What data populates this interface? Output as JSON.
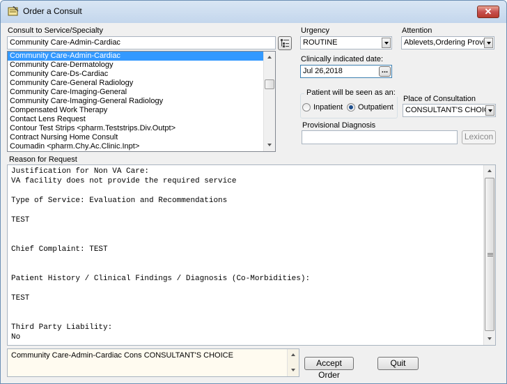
{
  "window": {
    "title": "Order a Consult",
    "close_symbol": "✕"
  },
  "service": {
    "label": "Consult to Service/Specialty",
    "value": "Community Care-Admin-Cardiac",
    "picker_icon": "tree-view-icon",
    "items": [
      "Community Care-Admin-Cardiac",
      "Community Care-Dermatology",
      "Community Care-Ds-Cardiac",
      "Community Care-General Radiology",
      "Community Care-Imaging-General",
      "Community Care-Imaging-General Radiology",
      "Compensated Work Therapy",
      "Contact Lens Request",
      "Contour Test Strips  <pharm.Teststrips.Div.Outpt>",
      "Contract Nursing Home Consult",
      "Coumadin  <pharm.Chy.Ac.Clinic.Inpt>"
    ],
    "selected_index": 0
  },
  "urgency": {
    "label": "Urgency",
    "value": "ROUTINE"
  },
  "attention": {
    "label": "Attention",
    "value": "Ablevets,Ordering Provic"
  },
  "clinical_date": {
    "label": "Clinically indicated date:",
    "value": "Jul 26,2018",
    "button_label": "..."
  },
  "patient_seen": {
    "label": "Patient will be seen as an:",
    "options": [
      {
        "label": "Inpatient",
        "checked": false
      },
      {
        "label": "Outpatient",
        "checked": true
      }
    ]
  },
  "place": {
    "label": "Place of Consultation",
    "value": "CONSULTANT'S CHOIC"
  },
  "diagnosis": {
    "label": "Provisional Diagnosis",
    "value": "",
    "lexicon_label": "Lexicon"
  },
  "reason": {
    "label": "Reason for Request",
    "lines": [
      "Justification for Non VA Care:",
      "VA facility does not provide the required service",
      "",
      "Type of Service: Evaluation and Recommendations",
      "",
      "TEST",
      "",
      "",
      "Chief Complaint: TEST",
      "",
      "",
      "Patient History / Clinical Findings / Diagnosis (Co-Morbidities):",
      "",
      "TEST",
      "",
      "",
      "Third Party Liability:",
      "No"
    ]
  },
  "order_summary": "Community Care-Admin-Cardiac Cons CONSULTANT'S CHOICE",
  "buttons": {
    "accept": "Accept Order",
    "quit": "Quit"
  },
  "colors": {
    "selection": "#3399ff",
    "close_button": "#c75050",
    "window_bg": "#f0f0f0"
  }
}
